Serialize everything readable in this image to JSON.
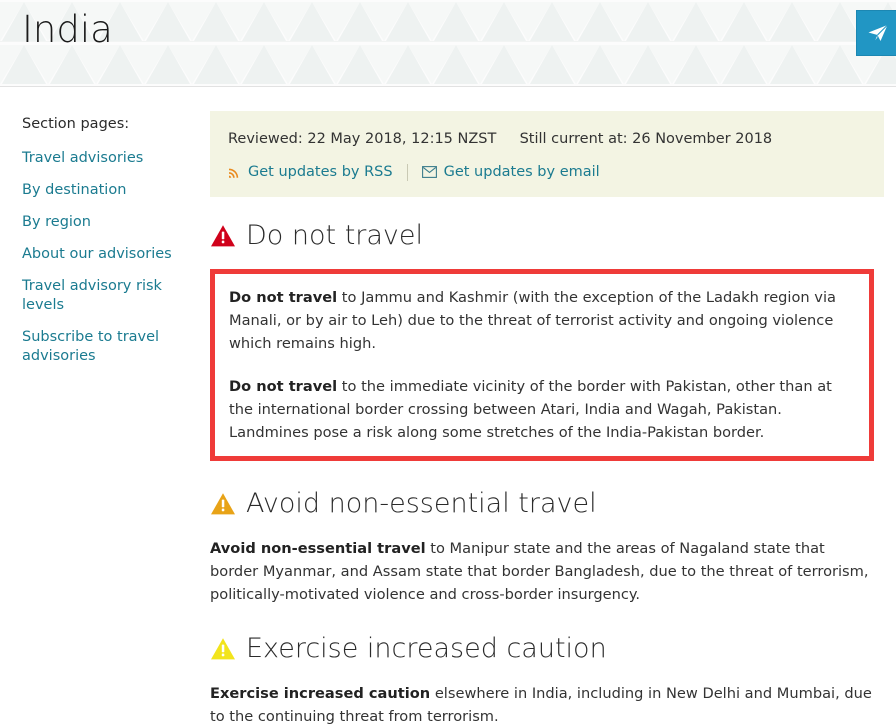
{
  "header": {
    "title": "India",
    "share_button": {
      "name": "share-button",
      "icon": "paper-plane-icon",
      "color": "#2196c4"
    }
  },
  "sidebar": {
    "heading": "Section pages:",
    "items": [
      {
        "label": "Travel advisories"
      },
      {
        "label": "By destination"
      },
      {
        "label": "By region"
      },
      {
        "label": "About our advisories"
      },
      {
        "label": "Travel advisory risk levels"
      },
      {
        "label": "Subscribe to travel advisories"
      }
    ],
    "link_color": "#1b7b90"
  },
  "review_notice": {
    "reviewed": "Reviewed: 22 May 2018, 12:15 NZST",
    "still_current": "Still current at: 26 November 2018",
    "rss_link": "Get updates by RSS",
    "email_link": "Get updates by email",
    "background": "#f3f4e3",
    "rss_icon_color": "#e98a1e"
  },
  "advisories": [
    {
      "heading": "Do not travel",
      "icon": "warning-triangle-red-icon",
      "icon_color": "#d0021b",
      "boxed": true,
      "box_border_color": "#ef3b39",
      "paragraphs": [
        {
          "lead": "Do not travel",
          "rest": " to Jammu and Kashmir (with the exception of the Ladakh region via Manali, or by air to Leh) due to the threat of terrorist activity and ongoing violence which remains high."
        },
        {
          "lead": "Do not travel",
          "rest": " to the immediate vicinity of the border with Pakistan, other than at the international border crossing between Atari, India and Wagah, Pakistan. Landmines pose a risk along some stretches of the India-Pakistan border."
        }
      ]
    },
    {
      "heading": "Avoid non-essential travel",
      "icon": "warning-triangle-orange-icon",
      "icon_color": "#e8a317",
      "boxed": false,
      "paragraphs": [
        {
          "lead": "Avoid non-essential travel",
          "rest": " to Manipur state and the areas of Nagaland state that border Myanmar, and Assam state that border Bangladesh, due to the threat of terrorism, politically-motivated violence and cross-border insurgency."
        }
      ]
    },
    {
      "heading": "Exercise increased caution",
      "icon": "warning-triangle-yellow-icon",
      "icon_color": "#f2e41c",
      "boxed": false,
      "paragraphs": [
        {
          "lead": "Exercise increased caution",
          "rest": " elsewhere in India, including in New Delhi and Mumbai, due to the continuing threat from terrorism."
        }
      ]
    }
  ]
}
